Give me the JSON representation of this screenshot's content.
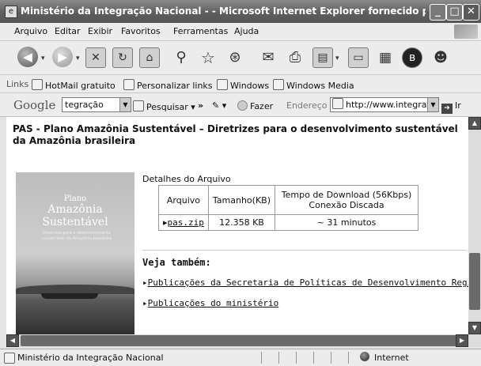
{
  "window": {
    "title": "Ministério da Integração Nacional - - Microsoft Internet Explorer fornecido por ...",
    "controls": {
      "minimize": "_",
      "maximize": "□",
      "close": "✕"
    }
  },
  "menu": [
    "Arquivo",
    "Editar",
    "Exibir",
    "Favoritos",
    "Ferramentas",
    "Ajuda"
  ],
  "links_bar": {
    "label": "Links",
    "items": [
      "HotMail gratuito",
      "Personalizar links",
      "Windows",
      "Windows Media"
    ]
  },
  "google_bar": {
    "logo": "Google",
    "search_value": "tegração",
    "search_button": "Pesquisar",
    "more": "»",
    "fazer": "Fazer",
    "address_label": "Endereço",
    "address_value": "http://www.integra",
    "go_button": "Ir"
  },
  "page": {
    "heading": "PAS - Plano Amazônia Sustentável – Diretrizes para o desenvolvimento sustentável da Amazônia brasileira",
    "cover": {
      "line1": "Plano",
      "line2": "Amazônia",
      "line3": "Sustentável",
      "subtitle": "Diretrizes para o desenvolvimento sustentável da Amazônia brasileira"
    },
    "file_details_label": "Detalhes do Arquivo",
    "table": {
      "headers": [
        "Arquivo",
        "Tamanho(KB)",
        "Tempo de Download (56Kbps) Conexão Discada"
      ],
      "row": {
        "file": "pas.zip",
        "size": "12.358 KB",
        "time": "~ 31 minutos"
      }
    },
    "see_also": "Veja também:",
    "links": [
      "Publicações da Secretaria de Políticas de Desenvolvimento Regional",
      "Publicações do ministério"
    ]
  },
  "status": {
    "text": "Ministério da Integração Nacional",
    "zone": "Internet"
  }
}
